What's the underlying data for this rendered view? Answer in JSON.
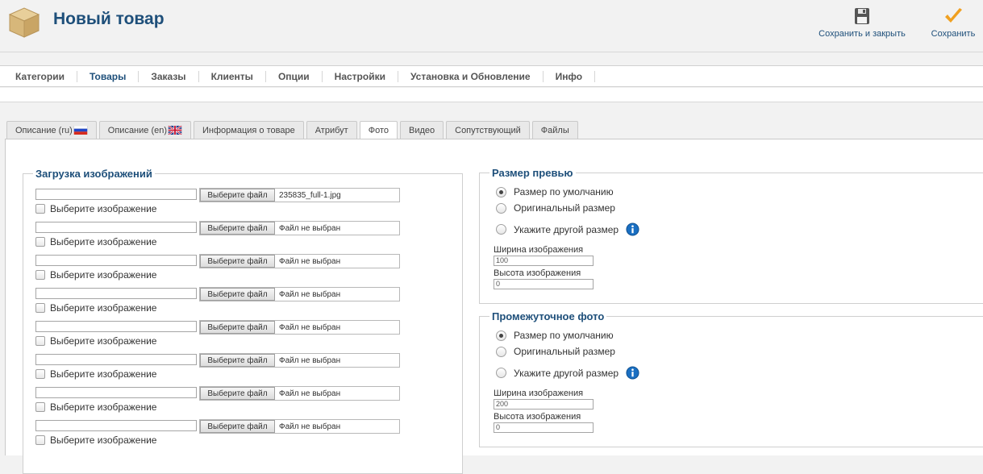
{
  "header": {
    "title": "Новый товар",
    "save_close_label": "Сохранить и закрыть",
    "save_label": "Сохранить"
  },
  "topnav": [
    "Категории",
    "Товары",
    "Заказы",
    "Клиенты",
    "Опции",
    "Настройки",
    "Установка и Обновление",
    "Инфо"
  ],
  "active_topnav": "Товары",
  "tabs": [
    "Описание (ru)",
    "Описание (en)",
    "Информация о товаре",
    "Атрибут",
    "Фото",
    "Видео",
    "Сопутствующий",
    "Файлы"
  ],
  "active_tab": "Фото",
  "upload": {
    "legend": "Загрузка изображений",
    "button_label": "Выберите файл",
    "checkbox_label": "Выберите изображение",
    "files": [
      "235835_full-1.jpg",
      "Файл не выбран",
      "Файл не выбран",
      "Файл не выбран",
      "Файл не выбран",
      "Файл не выбран",
      "Файл не выбран",
      "Файл не выбран"
    ]
  },
  "thumb": {
    "legend": "Размер превью",
    "options": [
      "Размер по умолчанию",
      "Оригинальный размер",
      "Укажите другой размер"
    ],
    "selected": 0,
    "width_label": "Ширина изображения",
    "width_value": "100",
    "height_label": "Высота изображения",
    "height_value": "0"
  },
  "mid": {
    "legend": "Промежуточное фото",
    "options": [
      "Размер по умолчанию",
      "Оригинальный размер",
      "Укажите другой размер"
    ],
    "selected": 0,
    "width_label": "Ширина изображения",
    "width_value": "200",
    "height_label": "Высота изображения",
    "height_value": "0"
  },
  "colors": {
    "accent": "#1e4f7a",
    "save_check": "#f0a020",
    "info": "#1a6fc2"
  }
}
